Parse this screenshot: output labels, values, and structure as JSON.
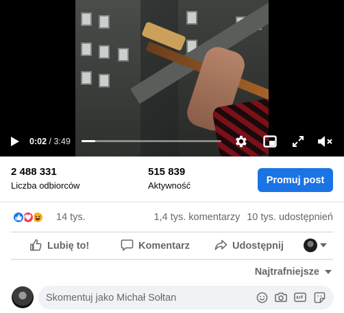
{
  "video": {
    "current_time": "0:02",
    "separator": " / ",
    "duration": "3:49",
    "progress_fraction": 0.1
  },
  "stats": {
    "reach_value": "2 488 331",
    "reach_label": "Liczba odbiorców",
    "engagement_value": "515 839",
    "engagement_label": "Aktywność",
    "promote_label": "Promuj post"
  },
  "reactions": {
    "icons": [
      "like-reaction",
      "love-reaction",
      "haha-reaction"
    ],
    "count": "14 tys.",
    "comments": "1,4 tys. komentarzy",
    "shares": "10 tys. udostępnień"
  },
  "actions": {
    "like": "Lubię to!",
    "comment": "Komentarz",
    "share": "Udostępnij"
  },
  "comments": {
    "sort_label": "Najtrafniejsze",
    "placeholder": "Skomentuj jako Michał Sołtan"
  },
  "colors": {
    "accent": "#1b74e4",
    "like": "#1877f2",
    "love": "#f33e58",
    "haha": "#f7b125",
    "secondary_text": "#65676b"
  }
}
